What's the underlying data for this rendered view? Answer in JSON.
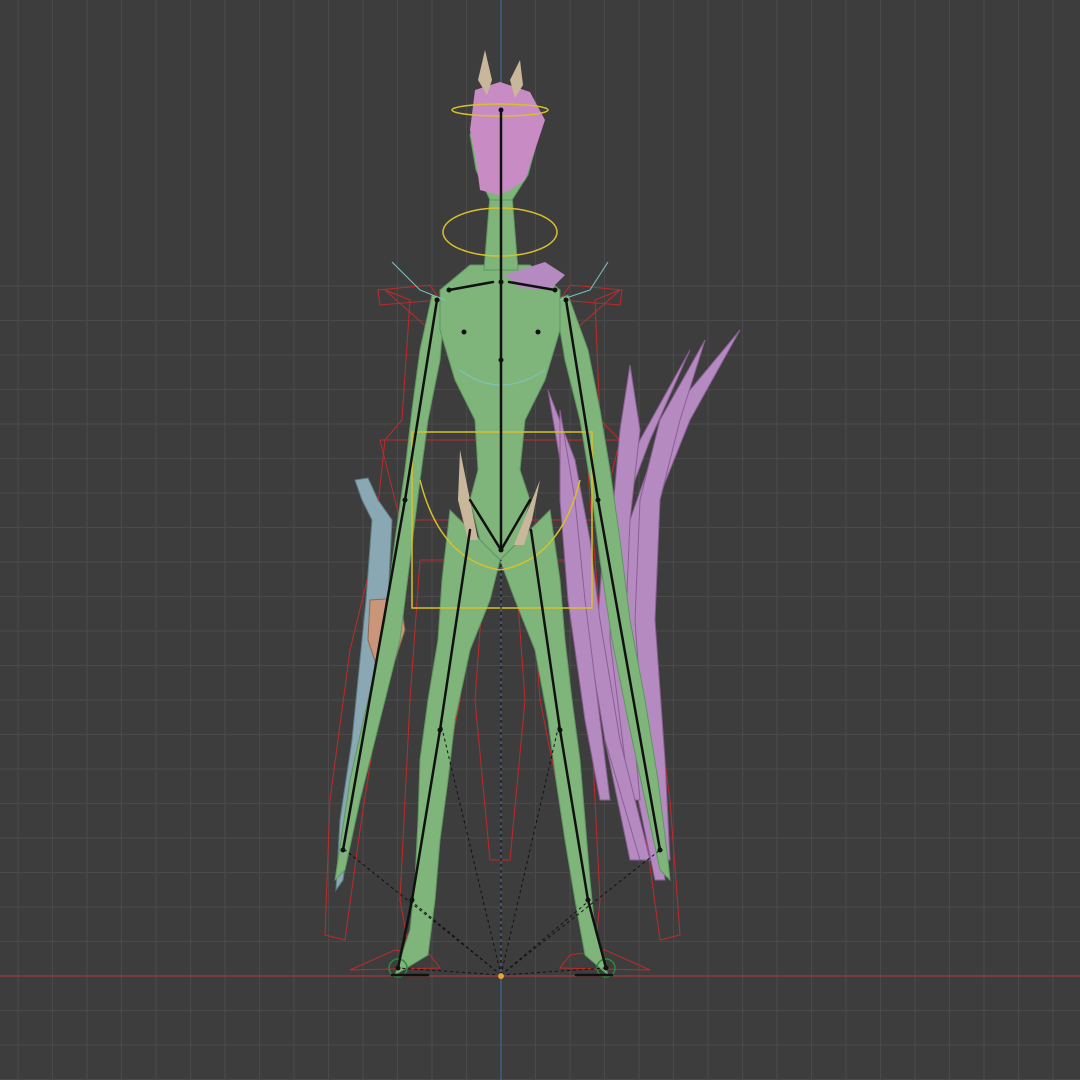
{
  "viewport": {
    "mode": "front-orthographic",
    "background_color": "#3d3d3d",
    "grid_major_color": "#4a4a4a",
    "grid_minor_color": "#434343",
    "x_axis_color": "#b23a3a",
    "z_axis_color": "#3a6fb2",
    "origin_marker_color": "#e8a23c"
  },
  "scene": {
    "character_body_color": "#7fb57a",
    "character_body_shadow": "#5e9660",
    "hair_color": "#c98bc4",
    "horn_color": "#c9b79b",
    "wing_color": "#b58ac0",
    "staff_color": "#8aa8b3",
    "staff_grip_color": "#c9967a",
    "bone_color": "#111111",
    "ik_control_color": "#d8c02a",
    "rig_outline_color": "#c02a2a",
    "selected_outline_color": "#7fc4c4",
    "foot_control_color": "#2a8a3a"
  }
}
